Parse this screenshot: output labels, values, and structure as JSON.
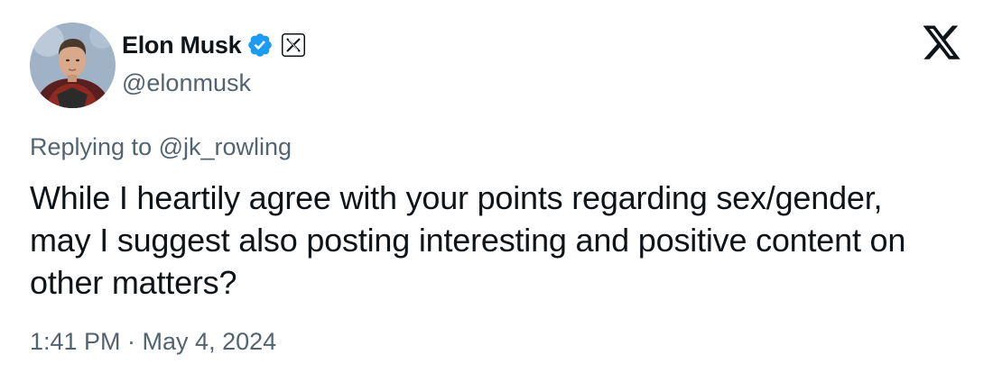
{
  "author": {
    "display_name": "Elon Musk",
    "handle": "@elonmusk",
    "avatar_icon": "profile-photo",
    "verified_icon": "verified-badge-icon",
    "verified_color": "#1d9bf0",
    "affiliation_icon": "x-affiliation-badge-icon"
  },
  "brand": {
    "logo_icon": "x-logo-icon"
  },
  "reply": {
    "prefix": "Replying to ",
    "target": "@jk_rowling"
  },
  "tweet": {
    "text": "While I heartily agree with your points regarding sex/gender, may I suggest also posting interesting and positive content on other matters?"
  },
  "meta": {
    "timestamp": "1:41 PM · May 4, 2024"
  },
  "colors": {
    "text_primary": "#0f1419",
    "text_secondary": "#536471",
    "link": "#536471",
    "background": "#ffffff"
  }
}
